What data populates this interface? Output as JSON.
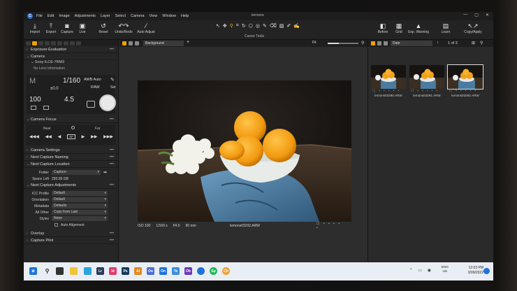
{
  "menubar": {
    "items": [
      "File",
      "Edit",
      "Image",
      "Adjustments",
      "Layer",
      "Select",
      "Camera",
      "View",
      "Window",
      "Help"
    ],
    "window_title": "lemons"
  },
  "toolbar": {
    "import": "Import",
    "export": "Export",
    "capture": "Capture",
    "live": "Live",
    "reset": "Reset",
    "undo_redo": "Undo/Redo",
    "auto_adjust": "Auto Adjust",
    "cursor_tools": "Cursor Tools",
    "before": "Before",
    "grid": "Grid",
    "exp_warning": "Exp. Warning",
    "learn": "Learn",
    "copy_apply": "Copy/Apply"
  },
  "left_panel": {
    "exposure_evaluation": "Exposure Evaluation",
    "camera": "Camera",
    "camera_model": "Sony ILCE-7RM3",
    "lens": "No Lens Information",
    "mode": "M",
    "shutter": "1/160",
    "ev": "±0.0",
    "iso": "100",
    "aperture": "4.5",
    "wb": "AWB Auto",
    "format": "RAW",
    "set": "Set",
    "camera_focus": "Camera Focus",
    "near": "Near",
    "far": "Far",
    "af": "AF",
    "camera_settings": "Camera Settings",
    "next_capture_naming": "Next Capture Naming",
    "next_capture_location": "Next Capture Location",
    "folder_label": "Folder",
    "folder_value": "Capture",
    "space_left_label": "Space Left",
    "space_left_value": "293.55 GB",
    "next_capture_adjustments": "Next Capture Adjustments",
    "icc_label": "ICC Profile",
    "icc_value": "Default",
    "orientation_label": "Orientation",
    "orientation_value": "Default",
    "metadata_label": "Metadata",
    "metadata_value": "Defaults",
    "all_other_label": "All Other",
    "all_other_value": "Copy from Last",
    "styles_label": "Styles",
    "styles_value": "None",
    "auto_alignment": "Auto Alignment",
    "overlay": "Overlay",
    "capture_pilot": "Capture Pilot"
  },
  "viewer": {
    "background_select": "Background",
    "fit": "Fit",
    "iso": "ISO 100",
    "shutter": "1/160 s",
    "aperture": "f/4.5",
    "focal": "90 mm",
    "filename": "lemons03292.ARW"
  },
  "browser": {
    "sort": "Date",
    "count": "1 of 3",
    "thumbs": [
      "lemons03290.ARW",
      "lemons03291.ARW",
      "lemons03292.ARW"
    ]
  },
  "taskbar": {
    "lang1": "ENG",
    "lang2": "US",
    "time": "12:03 PM",
    "date": "3/09/2022",
    "apps": [
      "Lr",
      "Id",
      "Ps",
      "Ai",
      "Ou",
      "On",
      "Te",
      "Ob",
      "Sp",
      "Ch"
    ]
  },
  "colors": {
    "accent": "#f0a000",
    "taskbar": "#e9eef4"
  }
}
